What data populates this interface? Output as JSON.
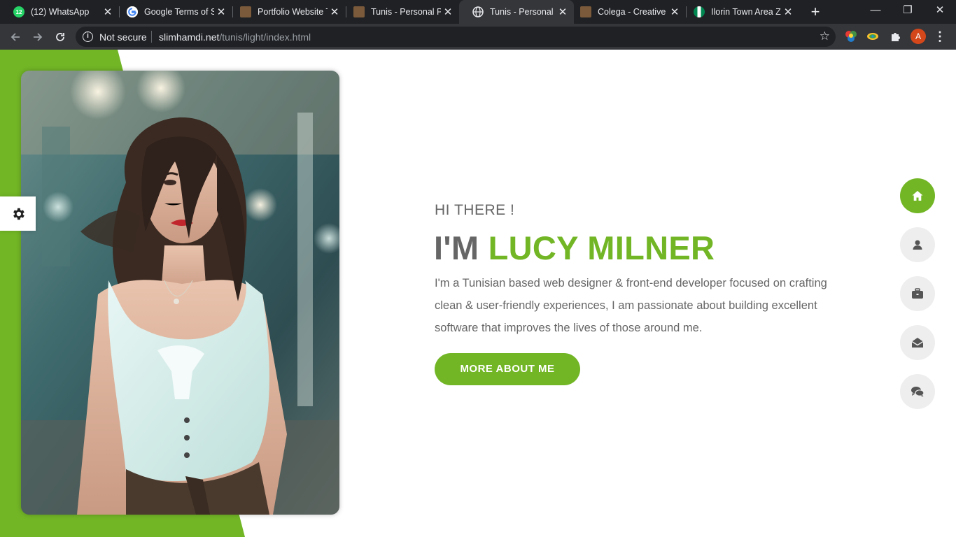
{
  "browser": {
    "tabs": [
      {
        "title": "(12) WhatsApp",
        "favicon": "whatsapp-icon",
        "badge": "12",
        "active": false
      },
      {
        "title": "Google Terms of S",
        "favicon": "google-icon",
        "active": false
      },
      {
        "title": "Portfolio Website T",
        "favicon": "page-icon",
        "active": false
      },
      {
        "title": "Tunis - Personal Po",
        "favicon": "page-icon",
        "active": false
      },
      {
        "title": "Tunis - Personal Po",
        "favicon": "globe-icon",
        "active": true
      },
      {
        "title": "Colega - Creative P",
        "favicon": "page-icon",
        "active": false
      },
      {
        "title": "Ilorin Town Area Zi",
        "favicon": "flag-icon",
        "active": false
      }
    ],
    "tab_close_glyph": "✕",
    "new_tab_glyph": "+",
    "window_controls": {
      "minimize": "—",
      "restore": "❐",
      "close": "✕"
    },
    "security_label": "Not secure",
    "url_host": "slimhamdi.net",
    "url_path": "/tunis/light/index.html",
    "profile_initial": "A"
  },
  "hero": {
    "greeting": "HI THERE !",
    "name_prefix": "I'M",
    "name_highlight": "LUCY MILNER",
    "bio": "I'm a Tunisian based web designer & front-end developer focused on crafting clean & user-friendly experiences, I am passionate about building excellent software that improves the lives of those around me.",
    "cta_label": "MORE ABOUT ME",
    "photo_alt": "portrait-photo"
  },
  "side_nav": [
    {
      "icon": "home-icon",
      "active": true
    },
    {
      "icon": "user-icon",
      "active": false
    },
    {
      "icon": "briefcase-icon",
      "active": false
    },
    {
      "icon": "envelope-open-icon",
      "active": false
    },
    {
      "icon": "comments-icon",
      "active": false
    }
  ],
  "colors": {
    "accent": "#72b626",
    "text_gray": "#666666",
    "chrome_dark": "#202124",
    "chrome_toolbar": "#35363a",
    "sidenav_bg": "#eeeeee"
  }
}
